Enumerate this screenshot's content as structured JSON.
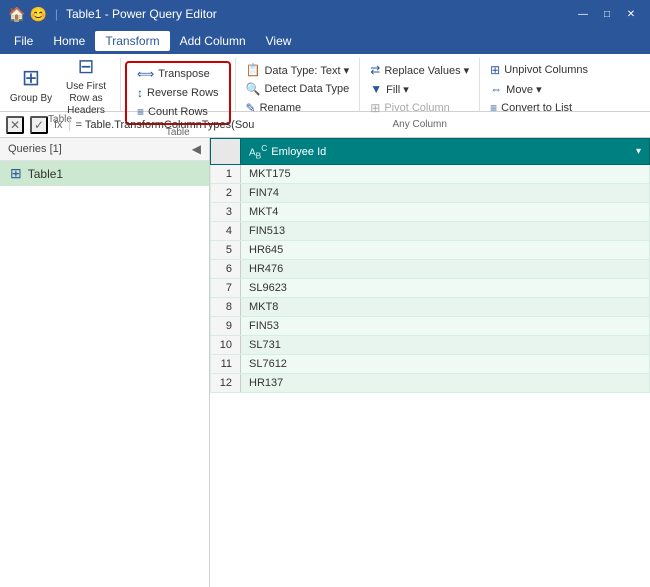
{
  "titleBar": {
    "title": "Table1 - Power Query Editor",
    "icons": [
      "🏠",
      "😊"
    ],
    "separator": "|",
    "controls": [
      "—",
      "□",
      "✕"
    ]
  },
  "menuBar": {
    "items": [
      "File",
      "Home",
      "Transform",
      "Add Column",
      "View"
    ],
    "activeItem": "Transform"
  },
  "ribbon": {
    "groups": [
      {
        "name": "group-by",
        "label": "Table",
        "buttons": [
          {
            "id": "group-by-btn",
            "label": "Group By",
            "icon": "⊞",
            "type": "large"
          },
          {
            "id": "use-first-row-btn",
            "label": "Use First Row as Headers",
            "icon": "⊟",
            "type": "large"
          }
        ]
      },
      {
        "name": "transform-group",
        "label": "Table",
        "bordered": true,
        "buttons": [
          {
            "id": "transpose-btn",
            "label": "Transpose",
            "icon": "⟺",
            "type": "small"
          },
          {
            "id": "reverse-rows-btn",
            "label": "Reverse Rows",
            "icon": "↕",
            "type": "small"
          },
          {
            "id": "count-rows-btn",
            "label": "Count Rows",
            "icon": "≡",
            "type": "small"
          }
        ]
      },
      {
        "name": "data-type-group",
        "label": "",
        "buttons": [
          {
            "id": "data-type-btn",
            "label": "Data Type: Text ▾",
            "icon": "📋",
            "type": "small"
          },
          {
            "id": "detect-data-type-btn",
            "label": "Detect Data Type",
            "icon": "🔍",
            "type": "small"
          },
          {
            "id": "rename-btn",
            "label": "Rename",
            "icon": "✎",
            "type": "small"
          }
        ]
      },
      {
        "name": "replace-values-group",
        "label": "",
        "buttons": [
          {
            "id": "replace-values-btn",
            "label": "Replace Values ▾",
            "icon": "⇄",
            "type": "small"
          },
          {
            "id": "fill-btn",
            "label": "Fill ▾",
            "icon": "▼",
            "type": "small"
          },
          {
            "id": "pivot-column-btn",
            "label": "Pivot Column",
            "icon": "⊞",
            "type": "small"
          }
        ]
      },
      {
        "name": "unpivot-group",
        "label": "",
        "buttons": [
          {
            "id": "unpivot-columns-btn",
            "label": "Unpivot Columns",
            "icon": "⊞",
            "type": "small"
          },
          {
            "id": "move-btn",
            "label": "Move ▾",
            "icon": "⇔",
            "type": "small"
          },
          {
            "id": "convert-to-list-btn",
            "label": "Convert to List",
            "icon": "≡",
            "type": "small"
          }
        ]
      }
    ],
    "groupLabels": {
      "table": "Table",
      "anyColumn": "Any Column"
    }
  },
  "formulaBar": {
    "cancelLabel": "✕",
    "confirmLabel": "✓",
    "functionLabel": "fx",
    "formula": "= Table.TransformColumnTypes(Sou"
  },
  "sidebar": {
    "header": "Queries [1]",
    "collapseIcon": "◀",
    "items": [
      {
        "id": "table1",
        "label": "Table1",
        "icon": "⊞",
        "selected": true
      }
    ]
  },
  "table": {
    "columns": [
      {
        "id": "employee-id",
        "label": "Emloyee Id",
        "typeIcon": "ABC"
      }
    ],
    "rows": [
      {
        "num": 1,
        "employeeId": "MKT175"
      },
      {
        "num": 2,
        "employeeId": "FIN74"
      },
      {
        "num": 3,
        "employeeId": "MKT4"
      },
      {
        "num": 4,
        "employeeId": "FIN513"
      },
      {
        "num": 5,
        "employeeId": "HR645"
      },
      {
        "num": 6,
        "employeeId": "HR476"
      },
      {
        "num": 7,
        "employeeId": "SL9623"
      },
      {
        "num": 8,
        "employeeId": "MKT8"
      },
      {
        "num": 9,
        "employeeId": "FIN53"
      },
      {
        "num": 10,
        "employeeId": "SL731"
      },
      {
        "num": 11,
        "employeeId": "SL7612"
      },
      {
        "num": 12,
        "employeeId": "HR137"
      }
    ]
  }
}
